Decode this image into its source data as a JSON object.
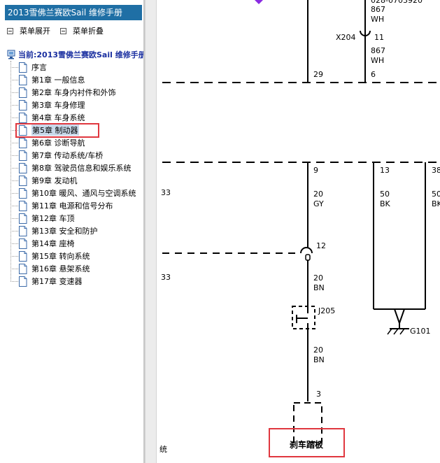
{
  "sidebar": {
    "title": "2013雪佛兰赛欧Sail 维修手册",
    "expand_label": "菜单展开",
    "collapse_label": "菜单折叠",
    "root_label": "当前:2013雪佛兰赛欧Sail 维修手册",
    "items": [
      {
        "label": "序言"
      },
      {
        "label": "第1章 一般信息"
      },
      {
        "label": "第2章 车身内衬件和外饰"
      },
      {
        "label": "第3章 车身修理"
      },
      {
        "label": "第4章 车身系统"
      },
      {
        "label": "第5章 制动器",
        "selected": true
      },
      {
        "label": "第6章 诊断导航"
      },
      {
        "label": "第7章 传动系统/车桥"
      },
      {
        "label": "第8章 驾驶员信息和娱乐系统"
      },
      {
        "label": "第9章 发动机"
      },
      {
        "label": "第10章 暖风、通风与空调系统"
      },
      {
        "label": "第11章 电源和信号分布"
      },
      {
        "label": "第12章 车顶"
      },
      {
        "label": "第13章 安全和防护"
      },
      {
        "label": "第14章 座椅"
      },
      {
        "label": "第15章 转向系统"
      },
      {
        "label": "第16章 悬架系统"
      },
      {
        "label": "第17章 变速器"
      }
    ]
  },
  "diagram": {
    "header_partial": "028-0703920",
    "wire_top_gauge": "867",
    "wire_top_color": "WH",
    "connector_x204": "X204",
    "pin_x204": "11",
    "wire_mid_gauge": "867",
    "wire_mid_color": "WH",
    "pin_6": "6",
    "pin_29": "29",
    "pin_9": "9",
    "wire_9_gauge": "20",
    "wire_9_color": "GY",
    "pin_13": "13",
    "wire_13_gauge": "50",
    "wire_13_color": "BK",
    "pin_38_partial": "38",
    "wire_38_gauge_partial": "50",
    "wire_38_color_partial": "BK",
    "left_label_1": "33",
    "left_label_2": "33",
    "splice_pin": "12",
    "wire_bn1_gauge": "20",
    "wire_bn1_color": "BN",
    "connector_j205": "J205",
    "wire_bn2_gauge": "20",
    "wire_bn2_color": "BN",
    "pin_3": "3",
    "ground_g101": "G101",
    "brake_pedal_label": "刹车踏板",
    "bottom_left_partial": "统"
  },
  "colors": {
    "title_bar": "#1f6fa5",
    "selection": "#c9d9ea",
    "highlight_box": "#e0373f"
  }
}
